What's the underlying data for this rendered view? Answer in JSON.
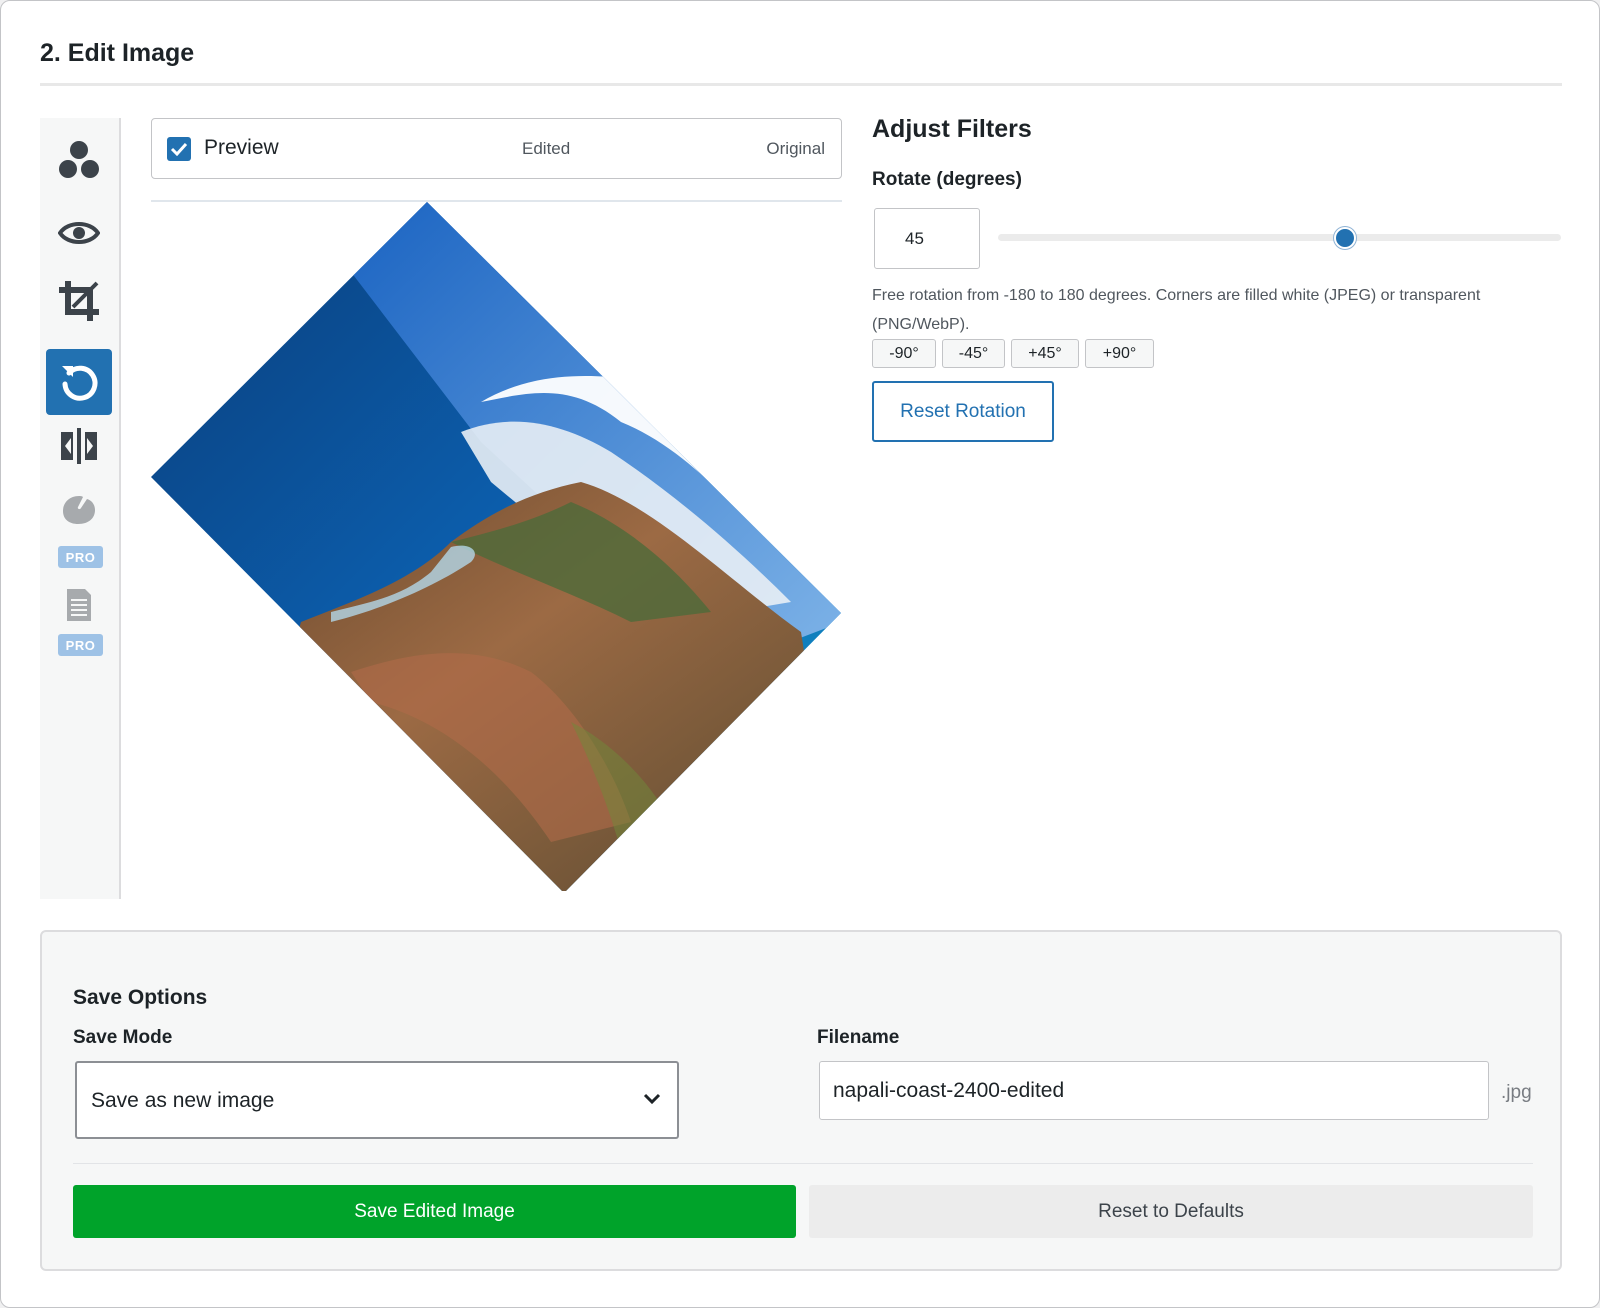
{
  "section": {
    "title": "2. Edit Image"
  },
  "toolbar": {
    "tools": [
      {
        "name": "filters",
        "icon": "circles-icon"
      },
      {
        "name": "preview",
        "icon": "eye-icon"
      },
      {
        "name": "crop",
        "icon": "crop-icon"
      },
      {
        "name": "rotate",
        "icon": "rotate-icon",
        "active": true
      },
      {
        "name": "flip",
        "icon": "flip-icon"
      },
      {
        "name": "color",
        "icon": "palette-icon",
        "badge": "PRO"
      },
      {
        "name": "document",
        "icon": "document-icon",
        "badge": "PRO"
      }
    ],
    "pro_label": "PRO"
  },
  "preview": {
    "checkbox_label": "Preview",
    "checked": true,
    "edited_label": "Edited",
    "original_label": "Original"
  },
  "filters": {
    "title": "Adjust Filters",
    "rotate_label": "Rotate (degrees)",
    "rotate_value": "45",
    "rotate_min": -180,
    "rotate_max": 180,
    "help_text": "Free rotation from -180 to 180 degrees. Corners are filled white (JPEG) or transparent (PNG/WebP).",
    "steps": [
      "-90°",
      "-45°",
      "+45°",
      "+90°"
    ],
    "reset_label": "Reset Rotation"
  },
  "save": {
    "title": "Save Options",
    "mode_label": "Save Mode",
    "mode_value": "Save as new image",
    "filename_label": "Filename",
    "filename_value": "napali-coast-2400-edited",
    "extension": ".jpg",
    "save_label": "Save Edited Image",
    "reset_label": "Reset to Defaults"
  },
  "colors": {
    "accent": "#2271b1",
    "save": "#00a32a",
    "pro": "#9ec2e6"
  }
}
